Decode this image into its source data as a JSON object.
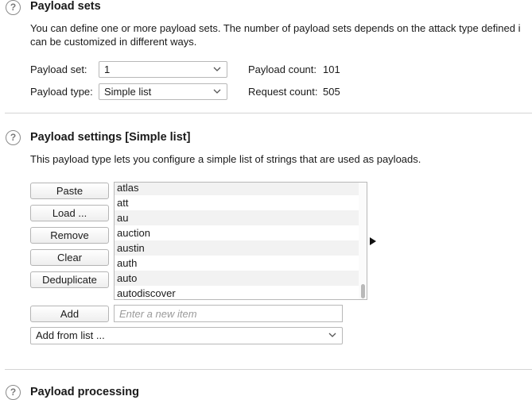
{
  "payload_sets": {
    "heading": "Payload sets",
    "description_line1": "You can define one or more payload sets. The number of payload sets depends on the attack type defined i",
    "description_line2": "can be customized in different ways.",
    "set_label": "Payload set:",
    "set_value": "1",
    "type_label": "Payload type:",
    "type_value": "Simple list",
    "count_label": "Payload count:",
    "count_value": "101",
    "request_label": "Request count:",
    "request_value": "505"
  },
  "payload_settings": {
    "heading": "Payload settings [Simple list]",
    "description": "This payload type lets you configure a simple list of strings that are used as payloads.",
    "buttons": {
      "paste": "Paste",
      "load": "Load ...",
      "remove": "Remove",
      "clear": "Clear",
      "deduplicate": "Deduplicate",
      "add": "Add"
    },
    "list_items": [
      "atlas",
      "att",
      "au",
      "auction",
      "austin",
      "auth",
      "auto",
      "autodiscover"
    ],
    "new_item_placeholder": "Enter a new item",
    "add_from_list": "Add from list ..."
  },
  "payload_processing": {
    "heading": "Payload processing"
  },
  "icons": {
    "help": "help-circle-icon",
    "dropdown": "chevron-down-icon",
    "expand": "triangle-right-icon"
  }
}
